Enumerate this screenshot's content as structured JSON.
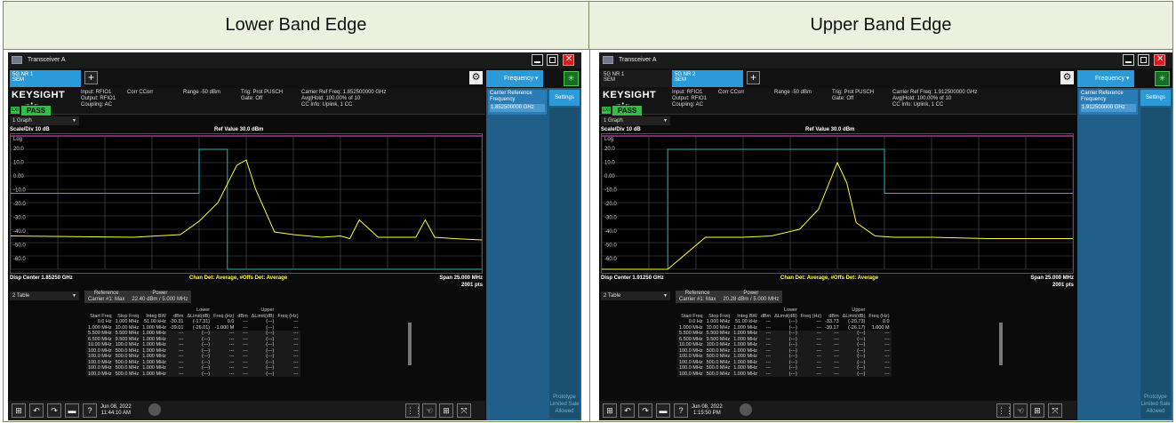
{
  "headers": {
    "left": "Lower Band Edge",
    "right": "Upper Band Edge"
  },
  "colors": {
    "header_bg": "#ebf1de",
    "trace": "#ffff33",
    "limit": "#2ab8b8",
    "pass": "#2fbf46",
    "accent": "#2a9bd8"
  },
  "left": {
    "title": "Transceiver A",
    "tabs": [
      "5G NR 1\nSEM"
    ],
    "freq_button": "Frequency",
    "logo": "KEYSIGHT",
    "pass": "PASS",
    "lxi": "LXI",
    "info": {
      "input": "Input: RFIO1\nOutput: RFIO1\nCoupling: AC",
      "corr": "Corr CCorr",
      "range": "Range -50 dBm",
      "trig": "Trig: Prot PUSCH\nGate: Off",
      "carrier": "Carrier Ref Freq: 1.852500000 GHz\nAvg|Hold: 100.00% of 10\nCC Info: Uplink, 1 CC"
    },
    "panel": {
      "label": "Carrier Reference Frequency",
      "value": "1.852500000 GHz",
      "settings": "Settings",
      "proto": "Prototype Limited Sale Allowed"
    },
    "graph_select": "1 Graph",
    "scale": "Scale/Div 10 dB",
    "log": "Log",
    "ref_value": "Ref Value 30.0 dBm",
    "y_ticks": [
      "20.0",
      "10.0",
      "0.00",
      "-10.0",
      "-20.0",
      "-30.0",
      "-40.0",
      "-50.0",
      "-60.0"
    ],
    "center": "Disp Center 1.85250 GHz",
    "det": "Chan Det: Average, #Offs Det: Average",
    "span": "Span 25.000 MHz",
    "pts": "2001 pts",
    "table_select": "2 Table",
    "ref": {
      "h1": "Reference",
      "h2": "Power",
      "c1": "Carrier #1: Max",
      "c2": "22.40 dBm / 5.000 MHz"
    },
    "sem": {
      "group_lower": "Lower",
      "group_upper": "Upper",
      "cols": [
        "Start Freq",
        "Stop Freq",
        "Integ BW",
        "dBm",
        "ΔLimit(dB)",
        "Freq (Hz)",
        "dBm",
        "ΔLimit(dB)",
        "Freq (Hz)"
      ],
      "rows": [
        [
          "0.0 Hz",
          "1.000 MHz",
          "51.00 kHz",
          "-30.31",
          "(-17.31)",
          "0.0",
          "---",
          "(---)",
          "---"
        ],
        [
          "1.000 MHz",
          "10.00 MHz",
          "1.000 MHz",
          "-39.01",
          "(-26.01)",
          "-1.000 M",
          "---",
          "(---)",
          "---"
        ],
        [
          "5.500 MHz",
          "5.500 MHz",
          "1.000 MHz",
          "---",
          "(---)",
          "---",
          "---",
          "(---)",
          "---"
        ],
        [
          "6.500 MHz",
          "9.500 MHz",
          "1.000 MHz",
          "---",
          "(---)",
          "---",
          "---",
          "(---)",
          "---"
        ],
        [
          "10.00 MHz",
          "100.0 MHz",
          "1.000 MHz",
          "---",
          "(---)",
          "---",
          "---",
          "(---)",
          "---"
        ],
        [
          "100.0 MHz",
          "500.0 MHz",
          "1.000 MHz",
          "---",
          "(---)",
          "---",
          "---",
          "(---)",
          "---"
        ],
        [
          "100.0 MHz",
          "500.0 MHz",
          "1.000 MHz",
          "---",
          "(---)",
          "---",
          "---",
          "(---)",
          "---"
        ],
        [
          "100.0 MHz",
          "500.0 MHz",
          "1.000 MHz",
          "---",
          "(---)",
          "---",
          "---",
          "(---)",
          "---"
        ],
        [
          "100.0 MHz",
          "500.0 MHz",
          "1.000 MHz",
          "---",
          "(---)",
          "---",
          "---",
          "(---)",
          "---"
        ],
        [
          "100.0 MHz",
          "500.0 MHz",
          "1.000 MHz",
          "---",
          "(---)",
          "---",
          "---",
          "(---)",
          "---"
        ]
      ]
    },
    "date": "Jun 08, 2022",
    "time": "11:44:10 AM"
  },
  "right": {
    "title": "Transceiver A",
    "tabs": [
      "5G NR 1\nSEM",
      "5G NR 2\nSEM"
    ],
    "freq_button": "Frequency",
    "logo": "KEYSIGHT",
    "pass": "PASS",
    "lxi": "LXI",
    "info": {
      "input": "Input: RFIO1\nOutput: RFIO1\nCoupling: AC",
      "corr": "Corr CCorr",
      "range": "Range -50 dBm",
      "trig": "Trig: Prot PUSCH\nGate: Off",
      "carrier": "Carrier Ref Freq: 1.912500000 GHz\nAvg|Hold: 100.00% of 10\nCC Info: Uplink, 1 CC"
    },
    "panel": {
      "label": "Carrier Reference Frequency",
      "value": "1.912500000 GHz",
      "settings": "Settings",
      "proto": "Prototype Limited Sale Allowed"
    },
    "graph_select": "1 Graph",
    "scale": "Scale/Div 10 dB",
    "log": "Log",
    "ref_value": "Ref Value 30.0 dBm",
    "y_ticks": [
      "20.0",
      "10.0",
      "0.00",
      "-10.0",
      "-20.0",
      "-30.0",
      "-40.0",
      "-50.0",
      "-60.0"
    ],
    "center": "Disp Center 1.91250 GHz",
    "det": "Chan Det: Average, #Offs Det: Average",
    "span": "Span 25.000 MHz",
    "pts": "2001 pts",
    "table_select": "2 Table",
    "ref": {
      "h1": "Reference",
      "h2": "Power",
      "c1": "Carrier #1: Max",
      "c2": "20.28 dBm / 5.000 MHz"
    },
    "sem": {
      "group_lower": "Lower",
      "group_upper": "Upper",
      "cols": [
        "Start Freq",
        "Stop Freq",
        "Integ BW",
        "dBm",
        "ΔLimit(dB)",
        "Freq (Hz)",
        "dBm",
        "ΔLimit(dB)",
        "Freq (Hz)"
      ],
      "rows": [
        [
          "0.0 Hz",
          "1.000 MHz",
          "51.00 kHz",
          "---",
          "(---)",
          "---",
          "-33.73",
          "(-20.73)",
          "0.0"
        ],
        [
          "1.000 MHz",
          "10.00 MHz",
          "1.000 MHz",
          "---",
          "(---)",
          "---",
          "-39.17",
          "(-26.17)",
          "1.000 M"
        ],
        [
          "5.500 MHz",
          "5.500 MHz",
          "1.000 MHz",
          "---",
          "(---)",
          "---",
          "---",
          "(---)",
          "---"
        ],
        [
          "6.500 MHz",
          "9.500 MHz",
          "1.000 MHz",
          "---",
          "(---)",
          "---",
          "---",
          "(---)",
          "---"
        ],
        [
          "10.00 MHz",
          "100.0 MHz",
          "1.000 MHz",
          "---",
          "(---)",
          "---",
          "---",
          "(---)",
          "---"
        ],
        [
          "100.0 MHz",
          "500.0 MHz",
          "1.000 MHz",
          "---",
          "(---)",
          "---",
          "---",
          "(---)",
          "---"
        ],
        [
          "100.0 MHz",
          "500.0 MHz",
          "1.000 MHz",
          "---",
          "(---)",
          "---",
          "---",
          "(---)",
          "---"
        ],
        [
          "100.0 MHz",
          "500.0 MHz",
          "1.000 MHz",
          "---",
          "(---)",
          "---",
          "---",
          "(---)",
          "---"
        ],
        [
          "100.0 MHz",
          "500.0 MHz",
          "1.000 MHz",
          "---",
          "(---)",
          "---",
          "---",
          "(---)",
          "---"
        ],
        [
          "100.0 MHz",
          "500.0 MHz",
          "1.000 MHz",
          "---",
          "(---)",
          "---",
          "---",
          "(---)",
          "---"
        ]
      ]
    },
    "date": "Jun 08, 2022",
    "time": "1:15:50 PM"
  },
  "chart_data": [
    {
      "type": "line",
      "x_range_mhz": [
        -12.5,
        12.5
      ],
      "ylim": [
        -70,
        30
      ],
      "series": [
        {
          "name": "",
          "x": [
            -12.5,
            -6.0,
            -3.5,
            -2.5,
            -1.5,
            -0.5,
            0.0,
            0.5,
            1.5,
            2.5,
            4.0,
            5.0,
            5.5,
            6.0,
            7.0,
            9.0,
            9.5,
            10.0,
            11.0,
            12.5
          ],
          "y": [
            -45,
            -46,
            -44,
            -34,
            -20,
            8,
            12,
            -10,
            -42,
            -44,
            -46,
            -45,
            -47,
            -33,
            -46,
            -46,
            -33,
            -46,
            -47,
            -48
          ]
        }
      ],
      "limit": {
        "x": [
          -12.5,
          -2.5,
          -2.5,
          -1.0,
          -1.0,
          12.5
        ],
        "y": [
          -13,
          -13,
          20,
          20,
          -70,
          -70
        ]
      }
    },
    {
      "type": "line",
      "x_range_mhz": [
        -12.5,
        12.5
      ],
      "ylim": [
        -70,
        30
      ],
      "series": [
        {
          "name": "",
          "x": [
            -12.5,
            -9.0,
            -7.0,
            -5.0,
            -3.5,
            -2.0,
            -1.0,
            0.0,
            0.5,
            1.0,
            2.0,
            3.0,
            5.0,
            8.0,
            12.5
          ],
          "y": [
            -70,
            -70,
            -46,
            -46,
            -45,
            -40,
            -25,
            10,
            -5,
            -35,
            -45,
            -46,
            -46,
            -47,
            -47
          ]
        }
      ],
      "limit": {
        "x": [
          -12.5,
          -9.0,
          -9.0,
          2.5,
          2.5,
          12.5
        ],
        "y": [
          -70,
          -70,
          20,
          20,
          -13,
          -13
        ]
      }
    }
  ]
}
